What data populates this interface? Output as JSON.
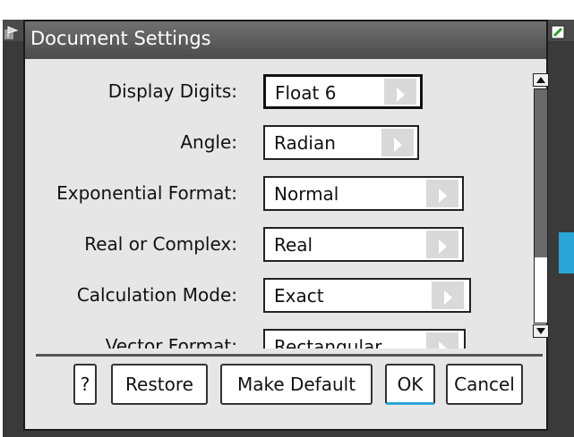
{
  "dialog": {
    "title": "Document Settings"
  },
  "settings": [
    {
      "label": "Display Digits:",
      "value": "Float 6",
      "focused": true
    },
    {
      "label": "Angle:",
      "value": "Radian",
      "focused": false
    },
    {
      "label": "Exponential Format:",
      "value": "Normal",
      "focused": false
    },
    {
      "label": "Real or Complex:",
      "value": "Real",
      "focused": false
    },
    {
      "label": "Calculation Mode:",
      "value": "Exact",
      "focused": false
    },
    {
      "label": "Vector Format:",
      "value": "Rectangular",
      "focused": false
    }
  ],
  "buttons": {
    "help": "?",
    "restore": "Restore",
    "make_default": "Make Default",
    "ok": "OK",
    "cancel": "Cancel"
  },
  "scroll": {
    "position_fraction": 0.0,
    "visible_fraction": 0.72
  },
  "colors": {
    "title_bar": "#5a5a5a",
    "accent": "#2aa6d6",
    "dialog_bg": "#e6e6e6"
  },
  "icons": {
    "top_left": "document-flag-icon",
    "top_right": "battery-status-icon",
    "dropdown": "triangle-right-icon",
    "scroll_up": "scroll-up-arrow-icon",
    "scroll_down": "scroll-down-arrow-icon"
  }
}
